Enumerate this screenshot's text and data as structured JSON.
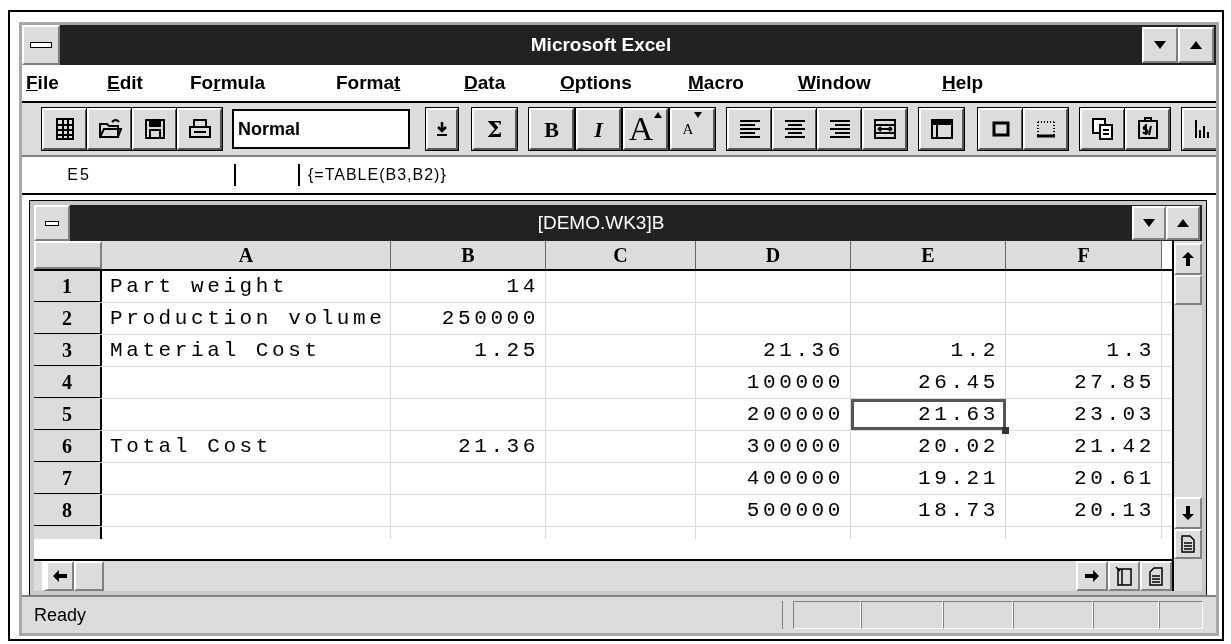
{
  "window": {
    "title": "Microsoft Excel"
  },
  "menu": [
    {
      "mnemonic": "F",
      "suffix": "ile"
    },
    {
      "mnemonic": "E",
      "suffix": "dit"
    },
    {
      "prefix": "Fo",
      "mnemonic": "r",
      "suffix": "mula"
    },
    {
      "prefix": "Forma",
      "mnemonic": "t"
    },
    {
      "mnemonic": "D",
      "suffix": "ata"
    },
    {
      "mnemonic": "O",
      "suffix": "ptions"
    },
    {
      "mnemonic": "M",
      "suffix": "acro"
    },
    {
      "mnemonic": "W",
      "suffix": "indow"
    },
    {
      "mnemonic": "H",
      "suffix": "elp"
    }
  ],
  "toolbar": {
    "style_box": "Normal",
    "text_buttons": [
      "Σ",
      "B",
      "I",
      "A",
      "A"
    ]
  },
  "formula_bar": {
    "cell_reference": "E5",
    "formula": "{=TABLE(B3,B2)}"
  },
  "workbook": {
    "title": "[DEMO.WK3]B",
    "columns": [
      {
        "label": "A",
        "kind": "text"
      },
      {
        "label": "B",
        "kind": "number"
      },
      {
        "label": "C",
        "kind": "number"
      },
      {
        "label": "D",
        "kind": "number"
      },
      {
        "label": "E",
        "kind": "number"
      },
      {
        "label": "F",
        "kind": "number"
      }
    ],
    "rows": [
      {
        "header": "1",
        "cells": [
          {
            "value": "Part weight",
            "selected": false
          },
          {
            "value": "14",
            "selected": false
          },
          {
            "selected": false
          },
          {
            "selected": false
          },
          {
            "selected": false
          },
          {
            "selected": false
          }
        ]
      },
      {
        "header": "2",
        "cells": [
          {
            "value": "Production volume",
            "selected": false
          },
          {
            "value": "250000",
            "selected": false
          },
          {
            "selected": false
          },
          {
            "selected": false
          },
          {
            "selected": false
          },
          {
            "selected": false
          }
        ]
      },
      {
        "header": "3",
        "cells": [
          {
            "value": "Material Cost",
            "selected": false
          },
          {
            "value": "1.25",
            "selected": false
          },
          {
            "selected": false
          },
          {
            "value": "21.36",
            "selected": false
          },
          {
            "value": "1.2",
            "selected": false
          },
          {
            "value": "1.3",
            "selected": false
          }
        ]
      },
      {
        "header": "4",
        "cells": [
          {
            "selected": false
          },
          {
            "selected": false
          },
          {
            "selected": false
          },
          {
            "value": "100000",
            "selected": false
          },
          {
            "value": "26.45",
            "selected": false
          },
          {
            "value": "27.85",
            "selected": false
          }
        ]
      },
      {
        "header": "5",
        "cells": [
          {
            "selected": false
          },
          {
            "selected": false
          },
          {
            "selected": false
          },
          {
            "value": "200000",
            "selected": false
          },
          {
            "value": "21.63",
            "selected": true
          },
          {
            "value": "23.03",
            "selected": false
          }
        ]
      },
      {
        "header": "6",
        "cells": [
          {
            "value": "Total Cost",
            "selected": false
          },
          {
            "value": "21.36",
            "selected": false
          },
          {
            "selected": false
          },
          {
            "value": "300000",
            "selected": false
          },
          {
            "value": "20.02",
            "selected": false
          },
          {
            "value": "21.42",
            "selected": false
          }
        ]
      },
      {
        "header": "7",
        "cells": [
          {
            "selected": false
          },
          {
            "selected": false
          },
          {
            "selected": false
          },
          {
            "value": "400000",
            "selected": false
          },
          {
            "value": "19.21",
            "selected": false
          },
          {
            "value": "20.61",
            "selected": false
          }
        ]
      },
      {
        "header": "8",
        "cells": [
          {
            "selected": false
          },
          {
            "selected": false
          },
          {
            "selected": false
          },
          {
            "value": "500000",
            "selected": false
          },
          {
            "value": "18.73",
            "selected": false
          },
          {
            "value": "20.13",
            "selected": false
          }
        ]
      }
    ]
  },
  "status_bar": {
    "text": "Ready"
  }
}
